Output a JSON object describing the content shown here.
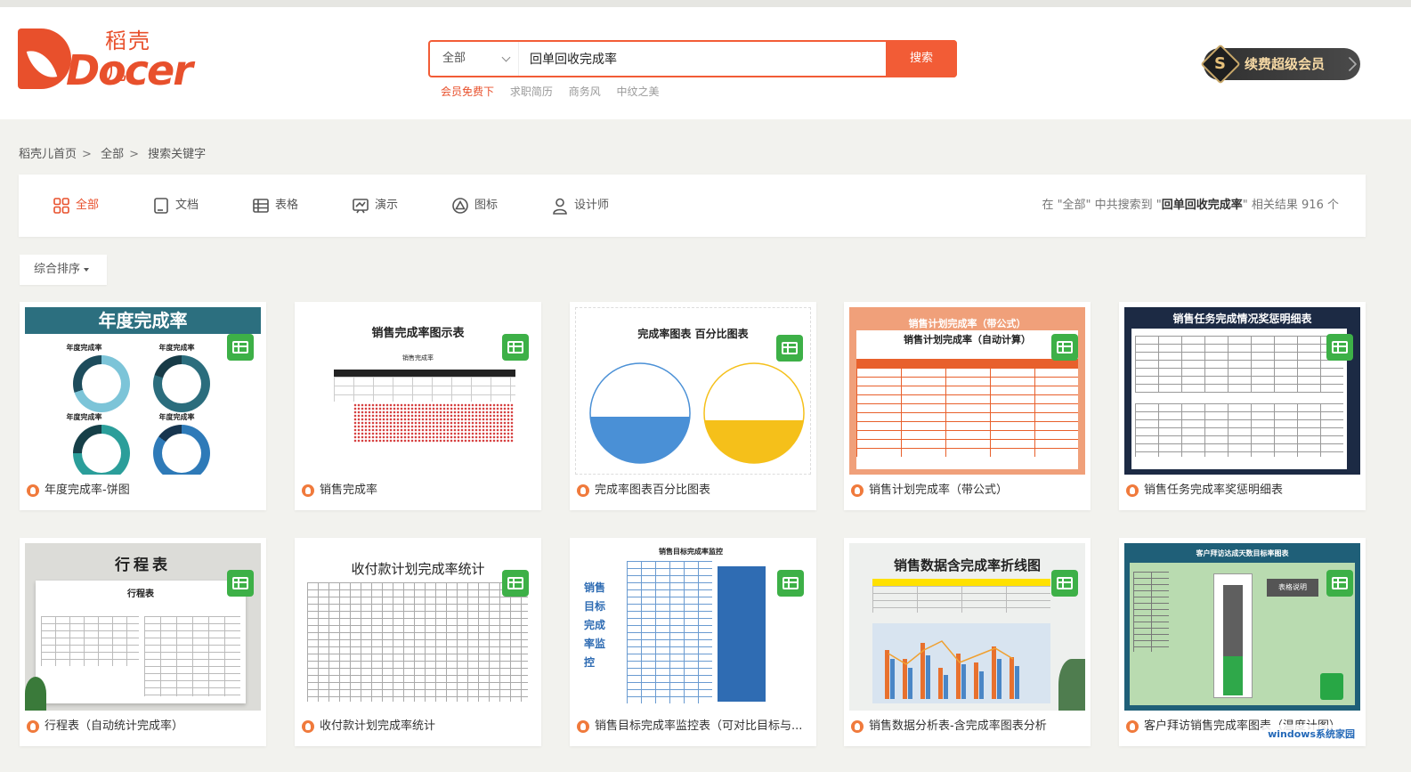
{
  "brand": {
    "name_cn": "稻壳儿",
    "name_en": "Docer"
  },
  "search": {
    "category": "全部",
    "query": "回单回收完成率",
    "button": "搜索"
  },
  "hot_tags": [
    "会员免费下",
    "求职简历",
    "商务风",
    "中纹之美"
  ],
  "vip_button": "续费超级会员",
  "breadcrumb": [
    "稻壳儿首页",
    "全部",
    "搜索关键字"
  ],
  "filter_tabs": [
    {
      "label": "全部",
      "icon": "grid-icon",
      "active": true
    },
    {
      "label": "文档",
      "icon": "document-icon"
    },
    {
      "label": "表格",
      "icon": "table-icon"
    },
    {
      "label": "演示",
      "icon": "presentation-icon"
    },
    {
      "label": "图标",
      "icon": "triangle-icon"
    },
    {
      "label": "设计师",
      "icon": "user-icon"
    }
  ],
  "result_summary": {
    "prefix": "在 \"全部\" 中共搜索到 \"",
    "keyword": "回单回收完成率",
    "suffix": "\" 相关结果 916 个"
  },
  "sort": "综合排序",
  "cards": [
    {
      "title": "年度完成率-饼图",
      "thumb_title": "年度完成率",
      "thumb_labels": [
        "年度完成率",
        "年度完成率",
        "年度完成率",
        "年度完成率"
      ]
    },
    {
      "title": "销售完成率",
      "thumb_title": "销售完成率图示表",
      "thumb_sub": "销售完成率"
    },
    {
      "title": "完成率图表百分比图表",
      "thumb_title": "完成率图表   百分比图表"
    },
    {
      "title": "销售计划完成率（带公式）",
      "thumb_title": "销售计划完成率（带公式）",
      "thumb_sub": "销售计划完成率（自动计算）"
    },
    {
      "title": "销售任务完成率奖惩明细表",
      "thumb_title": "销售任务完成情况奖惩明细表"
    },
    {
      "title": "行程表（自动统计完成率）",
      "thumb_title": "行程表",
      "thumb_sub": "行程表"
    },
    {
      "title": "收付款计划完成率统计",
      "thumb_title": "收付款计划完成率统计"
    },
    {
      "title": "销售目标完成率监控表（可对比目标与...",
      "thumb_title": "销售目标完成率监控",
      "thumb_side": "销售目标完成率监控"
    },
    {
      "title": "销售数据分析表-含完成率图表分析",
      "thumb_title": "销售数据含完成率折线图"
    },
    {
      "title": "客户拜访销售完成率图表（温度计图）",
      "thumb_title": "客户拜访达成天数目标率图表",
      "thumb_sub": "表格说明"
    }
  ],
  "watermark": "windows系统家园"
}
